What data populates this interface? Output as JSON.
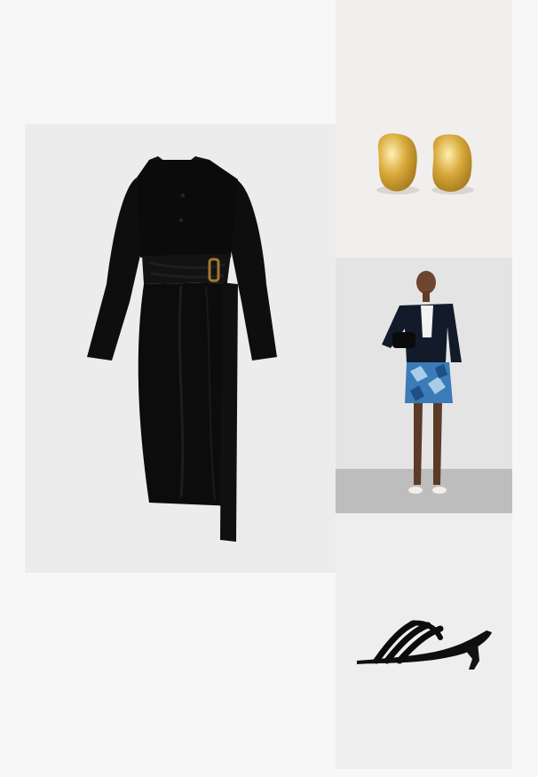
{
  "board": {
    "background_color": "#f7f7f7",
    "items": [
      {
        "id": "dress",
        "icon": "black-wrap-shirt-dress-image",
        "color": "#0d0d0d"
      },
      {
        "id": "earrings",
        "icon": "gold-earrings-image",
        "color": "#d4a63a"
      },
      {
        "id": "model",
        "icon": "model-outfit-photo",
        "color": "#2f6fa8"
      },
      {
        "id": "sandal",
        "icon": "black-strappy-mule-image",
        "color": "#111111"
      }
    ]
  }
}
